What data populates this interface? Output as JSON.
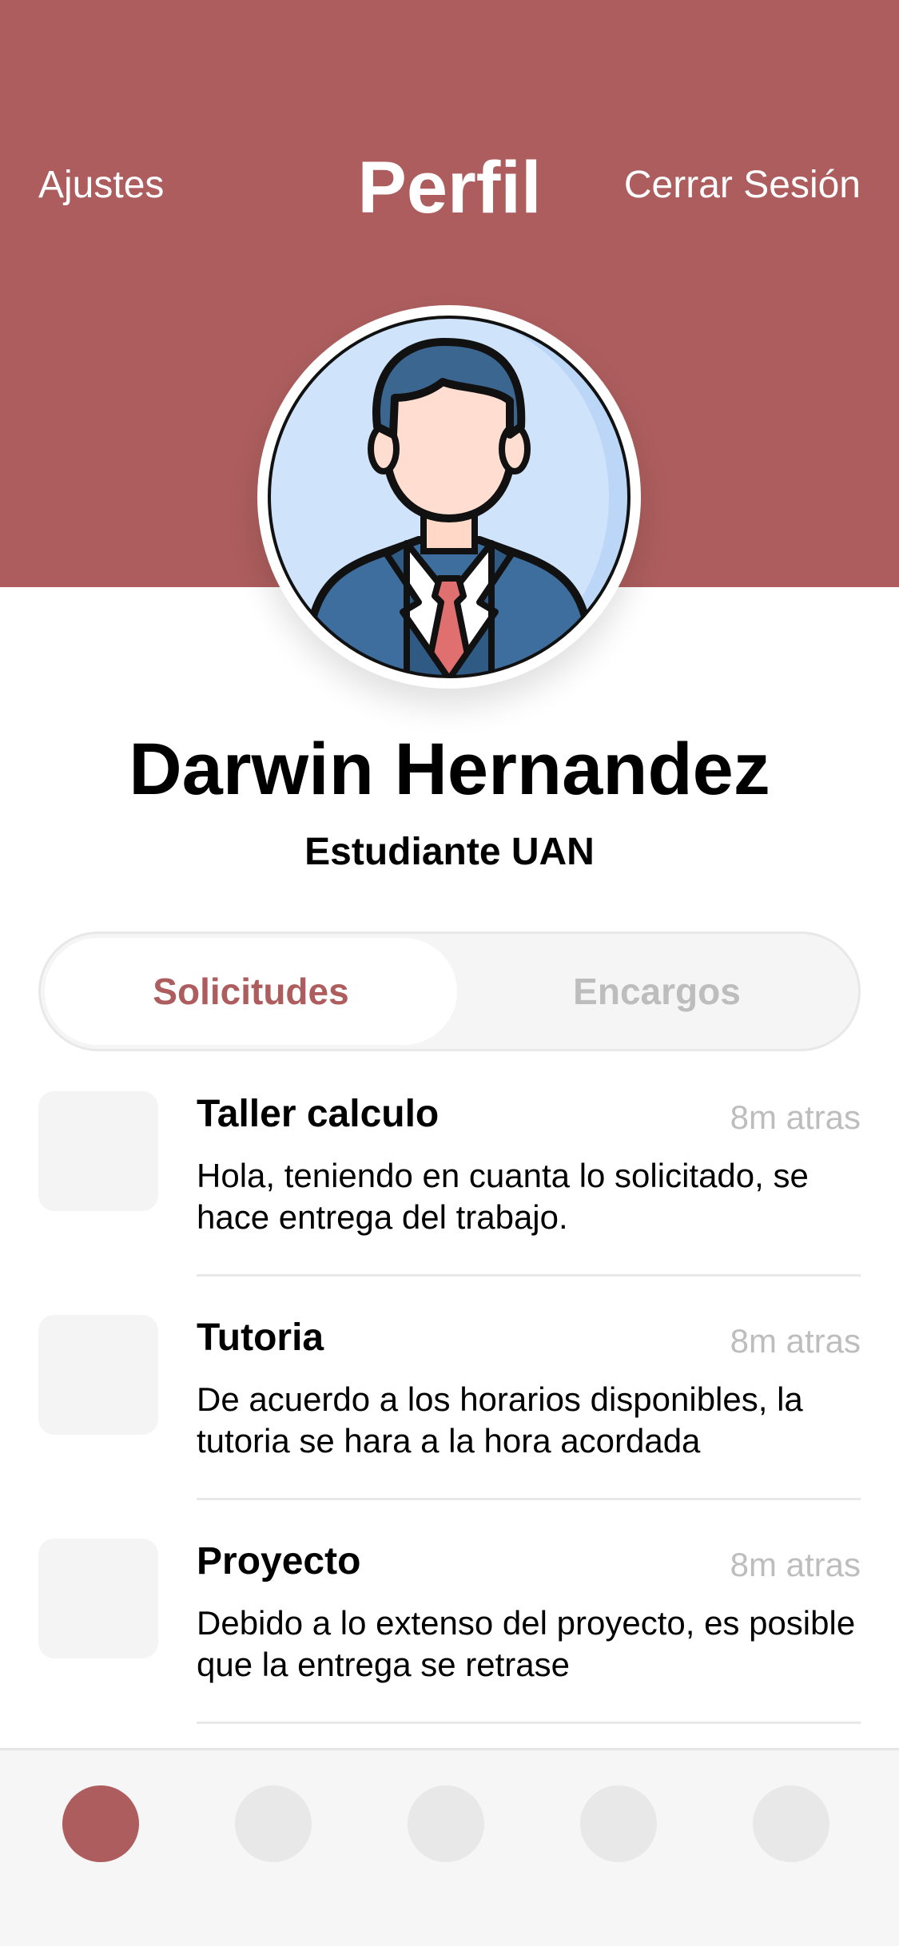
{
  "header": {
    "left_label": "Ajustes",
    "title": "Perfil",
    "right_label": "Cerrar Sesión",
    "background_color": "#ad5d5d"
  },
  "profile": {
    "avatar_icon": "businessman-avatar-icon",
    "name": "Darwin Hernandez",
    "role": "Estudiante UAN"
  },
  "segmented": {
    "active_tab": "Solicitudes",
    "inactive_tab": "Encargos",
    "selected_index": 0
  },
  "messages": [
    {
      "title": "Taller calculo",
      "time": "8m atras",
      "body": "Hola, teniendo en cuanta lo solicitado, se hace entrega del trabajo."
    },
    {
      "title": "Tutoria",
      "time": "8m atras",
      "body": "De acuerdo a los horarios disponibles, la tutoria se hara a la hora acordada"
    },
    {
      "title": "Proyecto",
      "time": "8m atras",
      "body": "Debido a lo extenso del proyecto, es posible que la entrega se retrase"
    }
  ],
  "tabbar": {
    "items": 5,
    "active_index": 0,
    "active_color": "#ad5d5d",
    "inactive_color": "#e8e8e8"
  }
}
